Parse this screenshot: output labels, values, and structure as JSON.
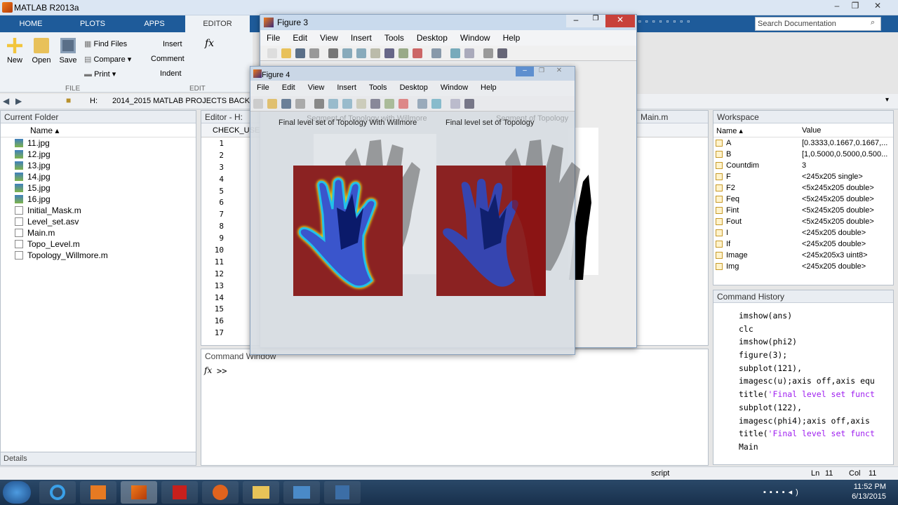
{
  "app": {
    "title": "MATLAB R2013a"
  },
  "ribbon": {
    "tabs": [
      "HOME",
      "PLOTS",
      "APPS",
      "EDITOR"
    ],
    "new": "New",
    "open": "Open",
    "save": "Save",
    "find_files": "Find Files",
    "compare": "Compare",
    "print": "Print",
    "insert": "Insert",
    "comment": "Comment",
    "indent": "Indent",
    "fx": "fx",
    "group_file": "FILE",
    "group_edit": "EDIT",
    "search_placeholder": "Search Documentation"
  },
  "address": {
    "drive": "H:",
    "path": "2014_2015 MATLAB PROJECTS BACKUP"
  },
  "current_folder": {
    "title": "Current Folder",
    "col_name": "Name",
    "files": [
      "11.jpg",
      "12.jpg",
      "13.jpg",
      "14.jpg",
      "15.jpg",
      "16.jpg",
      "Initial_Mask.m",
      "Level_set.asv",
      "Main.m",
      "Topo_Level.m",
      "Topology_Willmore.m"
    ],
    "details": "Details"
  },
  "editor": {
    "title": "Editor - H:",
    "tab": "CHECK_USER",
    "main_tab": "Main.m",
    "lines": [
      "1",
      "2",
      "3",
      "4",
      "5",
      "6",
      "7",
      "8",
      "9",
      "10",
      "11",
      "12",
      "13",
      "14",
      "15",
      "16",
      "17"
    ]
  },
  "command_window": {
    "title": "Command Window",
    "prompt": ">>",
    "fx": "fx"
  },
  "figure3": {
    "title": "Figure 3",
    "menus": [
      "File",
      "Edit",
      "View",
      "Insert",
      "Tools",
      "Desktop",
      "Window",
      "Help"
    ],
    "sub1_title": "Segment of Topology with Willmore",
    "sub2_title": "Segment of Topology"
  },
  "figure4": {
    "title": "Figure 4",
    "menus": [
      "File",
      "Edit",
      "View",
      "Insert",
      "Tools",
      "Desktop",
      "Window",
      "Help"
    ],
    "sub1_title": "Final level set of Topology With Willmore",
    "sub2_title": "Final level set of Topology"
  },
  "workspace": {
    "title": "Workspace",
    "col_name": "Name",
    "col_value": "Value",
    "vars": [
      {
        "name": "A",
        "value": "[0.3333,0.1667,0.1667,..."
      },
      {
        "name": "B",
        "value": "[1,0.5000,0.5000,0.500..."
      },
      {
        "name": "Countdim",
        "value": "3"
      },
      {
        "name": "F",
        "value": "<245x205 single>"
      },
      {
        "name": "F2",
        "value": "<5x245x205 double>"
      },
      {
        "name": "Feq",
        "value": "<5x245x205 double>"
      },
      {
        "name": "Fint",
        "value": "<5x245x205 double>"
      },
      {
        "name": "Fout",
        "value": "<5x245x205 double>"
      },
      {
        "name": "I",
        "value": "<245x205 double>"
      },
      {
        "name": "If",
        "value": "<245x205 double>"
      },
      {
        "name": "Image",
        "value": "<245x205x3 uint8>"
      },
      {
        "name": "Img",
        "value": "<245x205 double>"
      }
    ]
  },
  "history": {
    "title": "Command History",
    "lines": [
      {
        "code": "imshow(ans)"
      },
      {
        "code": "clc"
      },
      {
        "code": "imshow(phi2)"
      },
      {
        "code": "figure(3);"
      },
      {
        "code": "subplot(121),"
      },
      {
        "code": "imagesc(u);axis off,axis equ"
      },
      {
        "code": "title('Final level set funct"
      },
      {
        "code": "subplot(122),"
      },
      {
        "code": "imagesc(phi4);axis off,axis"
      },
      {
        "code": "title('Final level set funct"
      },
      {
        "code": "Main"
      }
    ]
  },
  "status": {
    "mode": "script",
    "ln_label": "Ln",
    "ln": "11",
    "col_label": "Col",
    "col": "11"
  },
  "taskbar": {
    "time": "11:52 PM",
    "date": "6/13/2015"
  }
}
